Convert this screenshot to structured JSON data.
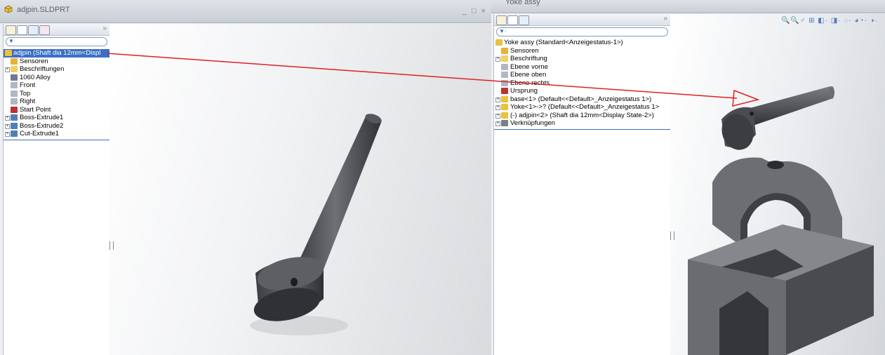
{
  "left_window": {
    "title": "adjpin.SLDPRT",
    "controls": "_ □ ×",
    "panel_more": "»",
    "tree": [
      {
        "label": "adjpin  (Shaft dia 12mm<Displ",
        "icon": "part-icon",
        "selected": true,
        "expander": ""
      },
      {
        "label": "Sensoren",
        "icon": "sensors-icon",
        "expander": ""
      },
      {
        "label": "Beschriftungen",
        "icon": "annotations-icon",
        "expander": "+"
      },
      {
        "label": "1060 Alloy",
        "icon": "material-icon",
        "expander": ""
      },
      {
        "label": "Front",
        "icon": "plane-icon",
        "expander": ""
      },
      {
        "label": "Top",
        "icon": "plane-icon",
        "expander": ""
      },
      {
        "label": "Right",
        "icon": "plane-icon",
        "expander": ""
      },
      {
        "label": "Start Point",
        "icon": "origin-icon",
        "expander": ""
      },
      {
        "label": "Boss-Extrude1",
        "icon": "feature-icon",
        "expander": "+"
      },
      {
        "label": "Boss-Extrude2",
        "icon": "feature-icon",
        "expander": "+"
      },
      {
        "label": "Cut-Extrude1",
        "icon": "feature-icon",
        "expander": "+"
      }
    ]
  },
  "right_window": {
    "title": "Yoke assy",
    "panel_more": "»",
    "toolbar_icons": "🔍🔍♂ ⊞ ◧· ◨· ◌· ◕◔· ◑·",
    "tree": [
      {
        "label": "Yoke assy  (Standard<Anzeigestatus-1>)",
        "icon": "assembly-icon",
        "expander": ""
      },
      {
        "label": "Sensoren",
        "icon": "sensors-icon",
        "expander": ""
      },
      {
        "label": "Beschriftung",
        "icon": "annotations-icon",
        "expander": "+"
      },
      {
        "label": "Ebene vorne",
        "icon": "plane-icon",
        "expander": ""
      },
      {
        "label": "Ebene oben",
        "icon": "plane-icon",
        "expander": ""
      },
      {
        "label": "Ebene rechts",
        "icon": "plane-icon",
        "expander": ""
      },
      {
        "label": "Ursprung",
        "icon": "origin-icon",
        "expander": ""
      },
      {
        "label": "base<1> (Default<<Default>_Anzeigestatus 1>)",
        "icon": "component-icon",
        "expander": "+"
      },
      {
        "label": "Yoke<1>->? (Default<<Default>_Anzeigestatus 1>",
        "icon": "component-icon",
        "expander": "+"
      },
      {
        "label": "(-) adjpin<2> (Shaft dia 12mm<Display State-2>)",
        "icon": "component-icon",
        "expander": "+"
      },
      {
        "label": "Verknüpfungen",
        "icon": "mates-icon",
        "expander": "+"
      }
    ]
  },
  "colors": {
    "selection": "#3b6fc5",
    "arrow": "#e02020",
    "part_grey": "#5b5d62"
  }
}
